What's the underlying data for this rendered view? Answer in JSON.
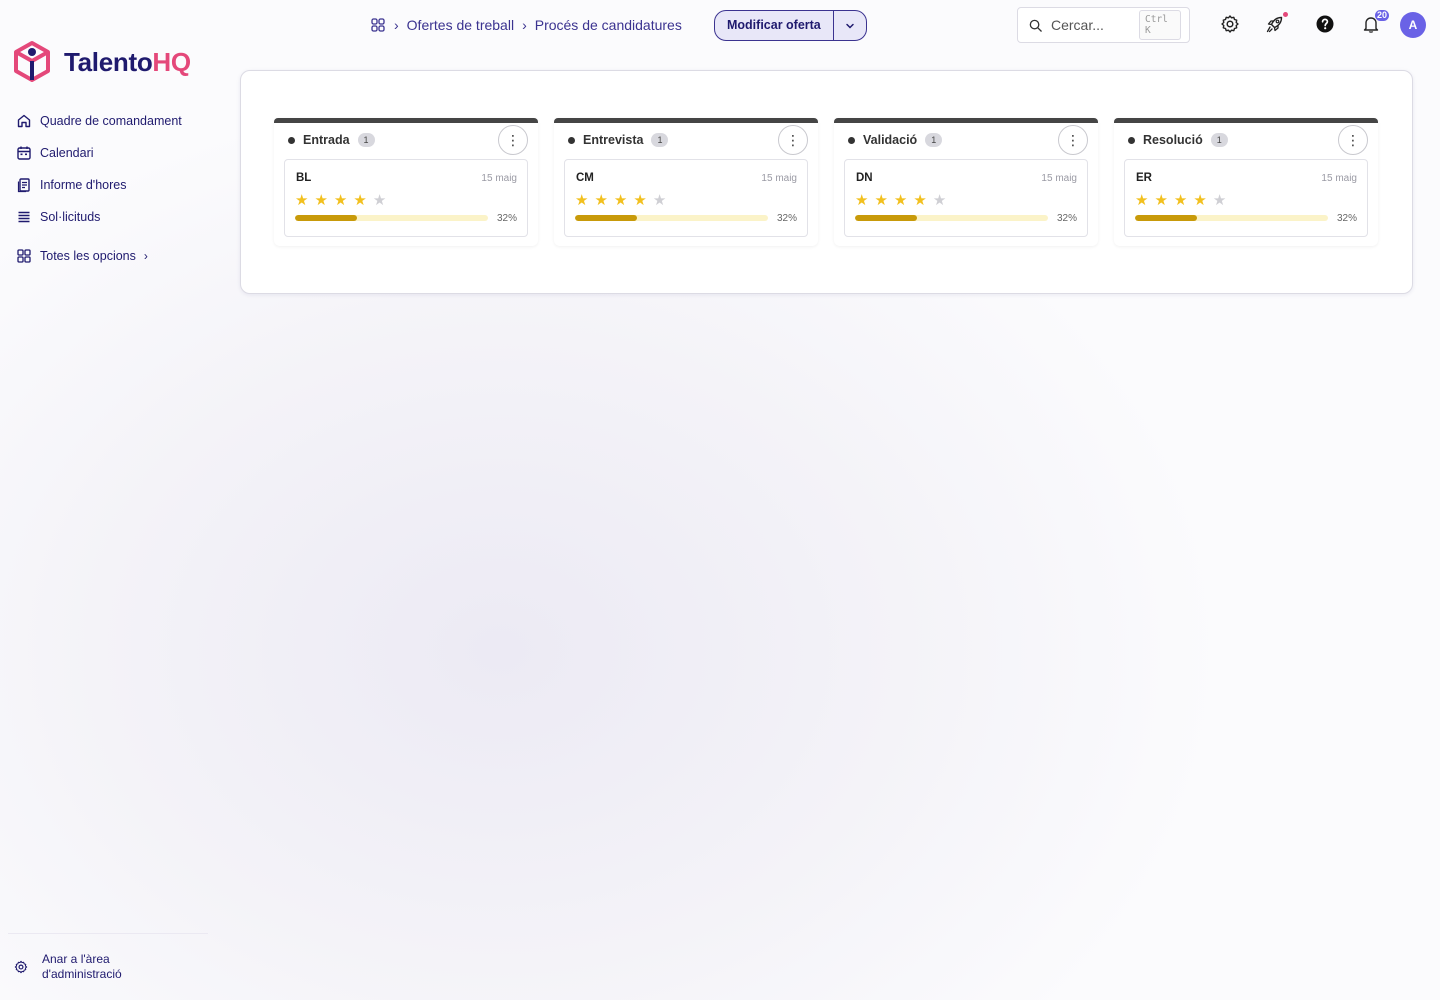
{
  "brand": {
    "name_part1": "Talento",
    "name_part2": "HQ"
  },
  "sidebar": {
    "items": [
      {
        "label": "Quadre de comandament",
        "icon": "home-icon"
      },
      {
        "label": "Calendari",
        "icon": "calendar-icon"
      },
      {
        "label": "Informe d'hores",
        "icon": "report-icon"
      },
      {
        "label": "Sol·licituds",
        "icon": "list-icon"
      }
    ],
    "all_options": "Totes les opcions",
    "admin_line1": "Anar a l'àrea",
    "admin_line2": "d'administració"
  },
  "breadcrumb": {
    "items": [
      "Ofertes de treball",
      "Procés de candidatures"
    ]
  },
  "actions": {
    "edit_offer": "Modificar oferta"
  },
  "search": {
    "placeholder": "Cercar...",
    "shortcut": "Ctrl K"
  },
  "header": {
    "notifications_count": "20",
    "avatar_initial": "A"
  },
  "board": {
    "columns": [
      {
        "title": "Entrada",
        "count": "1",
        "card": {
          "name": "BL",
          "date": "15 maig",
          "rating": 4,
          "max_rating": 5,
          "progress": 0.32,
          "progress_label": "32%"
        }
      },
      {
        "title": "Entrevista",
        "count": "1",
        "card": {
          "name": "CM",
          "date": "15 maig",
          "rating": 4,
          "max_rating": 5,
          "progress": 0.32,
          "progress_label": "32%"
        }
      },
      {
        "title": "Validació",
        "count": "1",
        "card": {
          "name": "DN",
          "date": "15 maig",
          "rating": 4,
          "max_rating": 5,
          "progress": 0.32,
          "progress_label": "32%"
        }
      },
      {
        "title": "Resolució",
        "count": "1",
        "card": {
          "name": "ER",
          "date": "15 maig",
          "rating": 4,
          "max_rating": 5,
          "progress": 0.32,
          "progress_label": "32%"
        }
      }
    ]
  },
  "colors": {
    "brand_dark": "#1f1a6e",
    "brand_accent": "#e4487a",
    "star": "#f2c01e",
    "progress": "#c89a0a",
    "badge": "#6a62e6"
  }
}
